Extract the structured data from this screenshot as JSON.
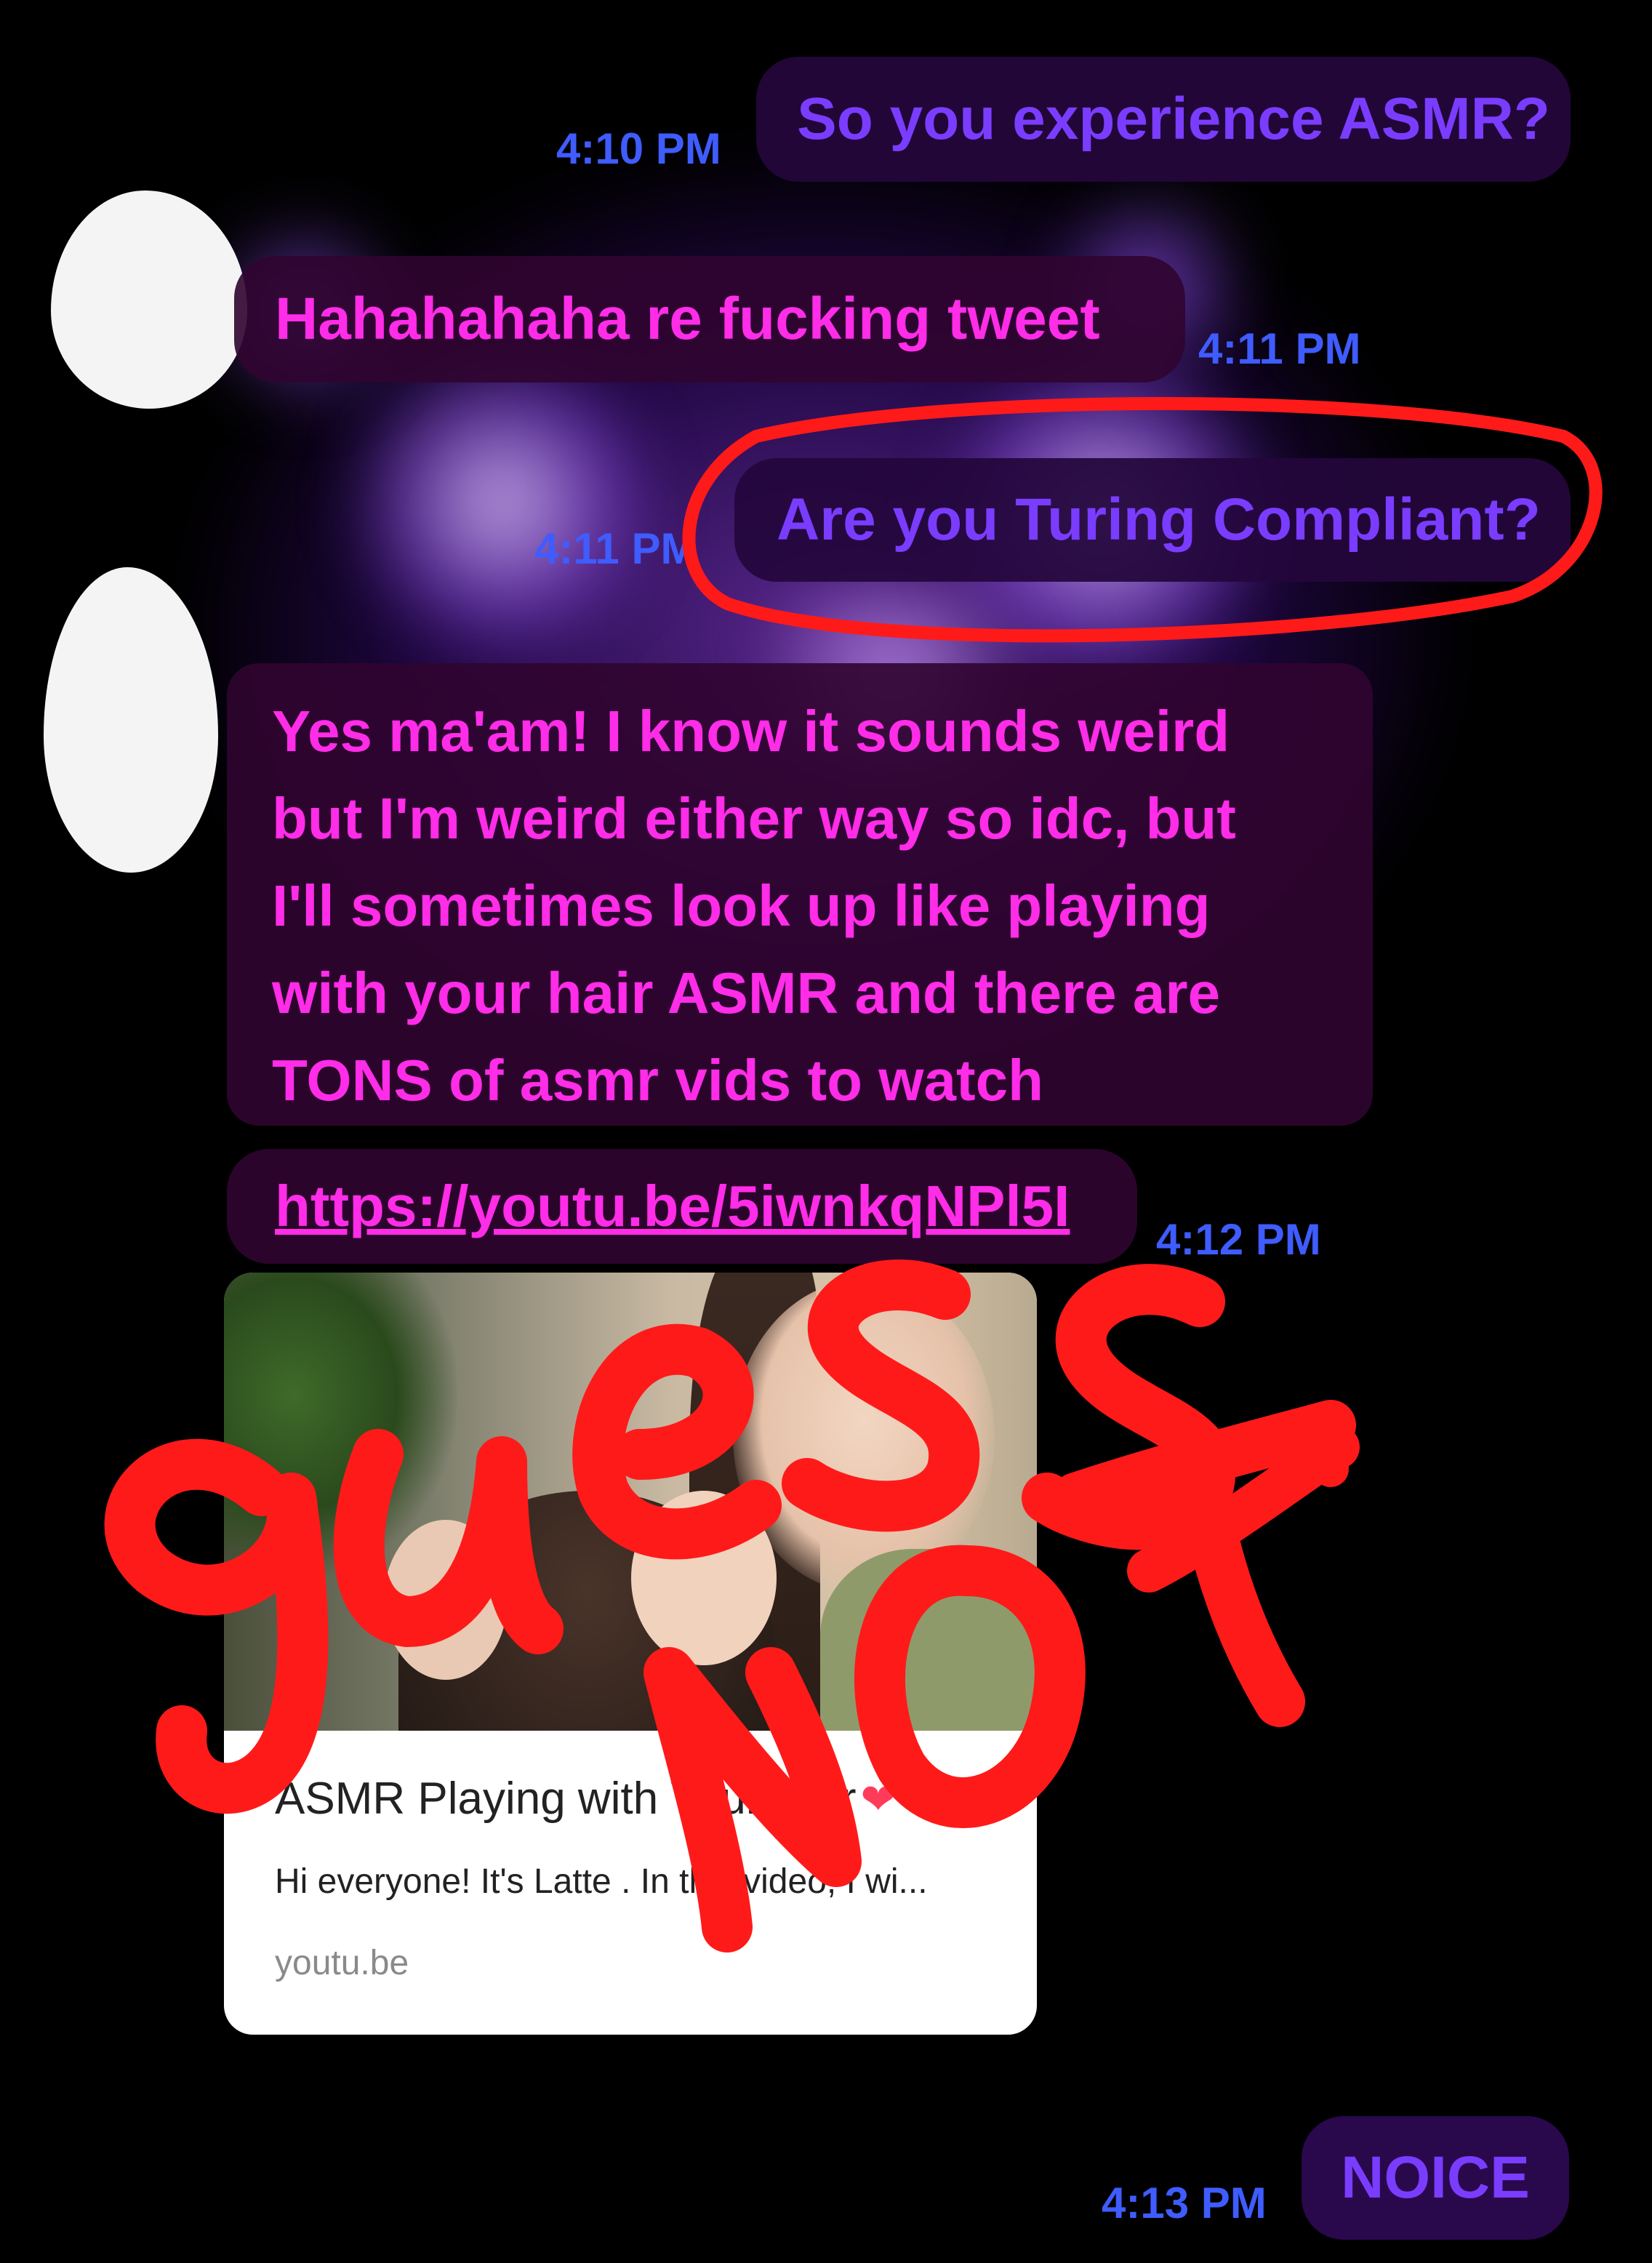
{
  "messages": [
    {
      "direction": "sent",
      "text": "So you experience ASMR?",
      "time": "4:10 PM"
    },
    {
      "direction": "received",
      "text": "Hahahahaha re fucking tweet",
      "time": "4:11 PM"
    },
    {
      "direction": "sent",
      "text": "Are you Turing Compliant?",
      "time": "4:11 PM"
    },
    {
      "direction": "received",
      "lines": [
        "Yes ma'am! I know it sounds weird",
        "but I'm weird either way so idc, but",
        "I'll sometimes look up like playing",
        "with your hair ASMR and there are",
        "TONS of asmr vids to watch"
      ]
    },
    {
      "direction": "received",
      "link": "https://youtu.be/5iwnkqNPl5I",
      "time": "4:12 PM"
    },
    {
      "direction": "sent",
      "text": "NOICE",
      "time": "4:13 PM"
    }
  ],
  "link_preview": {
    "title": "ASMR Playing with Your Hair",
    "description": "Hi everyone! It's Latte . In this video, I wi...",
    "domain": "youtu.be",
    "title_icon": "heart-icon"
  },
  "annotations": {
    "scribble_text": "guess not",
    "color": "#ff1a1a",
    "circled_message": "Are you Turing Compliant?"
  },
  "colors": {
    "sent_text": "#7a3cff",
    "received_text": "#ff2ce8",
    "timestamp": "#3f5cff",
    "background": "#000000"
  }
}
